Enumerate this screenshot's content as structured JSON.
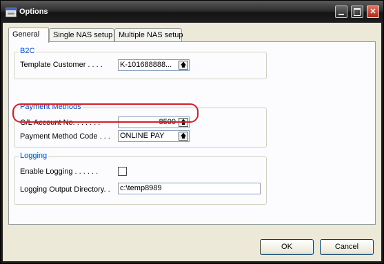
{
  "window": {
    "title": "Options",
    "icons": {
      "app": "table-icon",
      "minimize": "minimize-icon",
      "maximize": "maximize-icon",
      "close": "close-icon"
    }
  },
  "tabs": [
    {
      "label": "General",
      "active": true
    },
    {
      "label": "Single NAS setup",
      "active": false
    },
    {
      "label": "Multiple NAS setup",
      "active": false
    }
  ],
  "b2c": {
    "legend": "B2C",
    "template_customer_label": "Template Customer . . . .",
    "template_customer_value": "K-101688888..."
  },
  "payment_methods": {
    "legend": "Payment Methods",
    "gl_account_label": "G/L Account No. . . . . . .",
    "gl_account_value": "8500",
    "payment_method_code_label": "Payment Method Code . . .",
    "payment_method_code_value": "ONLINE PAY"
  },
  "logging": {
    "legend": "Logging",
    "enable_logging_label": "Enable Logging . . . . . .",
    "enable_logging_checked": false,
    "output_directory_label": "Logging Output Directory. .",
    "output_directory_value": "c:\\temp8989"
  },
  "buttons": {
    "ok": "OK",
    "cancel": "Cancel"
  },
  "colors": {
    "highlight": "#d81c28",
    "legend_text": "#0046d5",
    "active_tab_accent": "#ffc83c"
  }
}
